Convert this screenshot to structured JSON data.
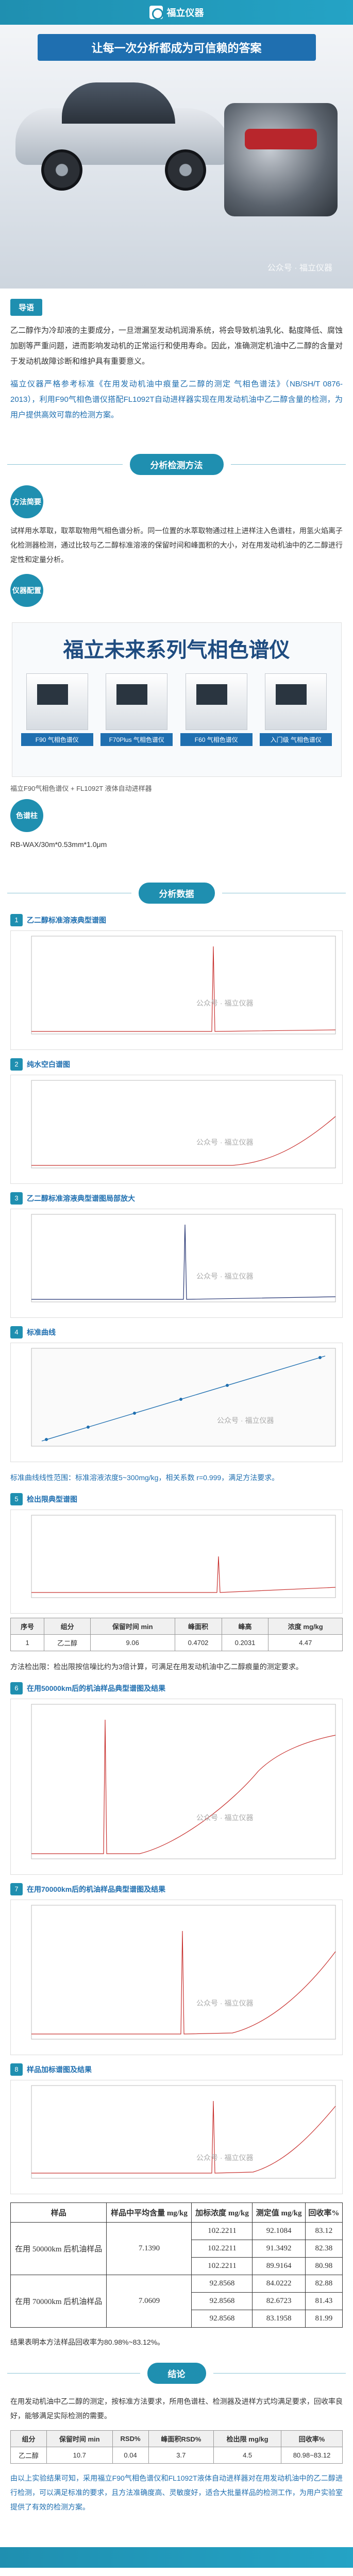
{
  "header": {
    "logo_text": "福立仪器",
    "title": "让每一次分析都成为可信赖的答案",
    "watermark": "公众号 · 福立仪器"
  },
  "intro": {
    "tag": "导语",
    "p1": "乙二醇作为冷却液的主要成分，一旦泄漏至发动机润滑系统，将会导致机油乳化、黏度降低、腐蚀加剧等严重问题，进而影响发动机的正常运行和使用寿命。因此，准确测定机油中乙二醇的含量对于发动机故障诊断和维护具有重要意义。",
    "p2": "福立仪器严格参考标准《在用发动机油中痕量乙二醇的测定 气相色谱法》（NB/SH/T 0876-2013），利用F90气相色谱仪搭配FL1092T自动进样器实现在用发动机油中乙二醇含量的检测，为用户提供高效可靠的检测方案。"
  },
  "method": {
    "section_title": "分析检测方法",
    "tag": "方法简要",
    "p1": "试样用水萃取，取萃取物用气相色谱分析。同一位置的水萃取物通过柱上进样注入色谱柱，用氢火焰离子化检测器检测，通过比较与乙二醇标准溶液的保留时间和峰面积的大小，对在用发动机油中的乙二醇进行定性和定量分析。",
    "config_tag": "仪器配置",
    "instrument_title": "福立未来系列气相色谱仪",
    "instruments": [
      "F90 气相色谱仪",
      "F70Plus 气相色谱仪",
      "F60 气相色谱仪",
      "入门级 气相色谱仪"
    ],
    "config_caption": "福立F90气相色谱仪 + FL1092T 液体自动进样器",
    "column_tag": "色谱柱",
    "column": "RB-WAX/30m*0.53mm*1.0μm"
  },
  "results": {
    "section_title": "分析数据",
    "fig1": "乙二醇标准溶液典型谱图",
    "fig2": "纯水空白谱图",
    "fig3": "乙二醇标准溶液典型谱图局部放大",
    "fig4": "标准曲线",
    "linearity": "标准曲线线性范围：标准溶液浓度5~300mg/kg，相关系数 r=0.999，满足方法要求。",
    "fig5": "检出限典型谱图",
    "lod_table": {
      "headers": [
        "序号",
        "组分",
        "保留时间 min",
        "峰面积",
        "峰高",
        "浓度 mg/kg"
      ],
      "rows": [
        [
          "1",
          "乙二醇",
          "9.06",
          "0.4702",
          "0.2031",
          "4.47"
        ]
      ]
    },
    "lod_text": "方法检出限：检出限按信噪比约为3倍计算，可满足在用发动机油中乙二醇痕量的测定要求。",
    "fig6": "在用50000km后的机油样品典型谱图及结果",
    "fig7": "在用70000km后的机油样品典型谱图及结果",
    "fig8": "样品加标谱图及结果",
    "wm": "公众号 · 福立仪器",
    "result_table": {
      "headers": [
        "样品",
        "样品中平均含量 mg/kg",
        "加标浓度 mg/kg",
        "测定值 mg/kg",
        "回收率%"
      ],
      "rows": [
        [
          "在用 50000km 后机油样品",
          "7.1390",
          "102.2211",
          "92.1084",
          "83.12"
        ],
        [
          "",
          "",
          "102.2211",
          "91.3492",
          "82.38"
        ],
        [
          "",
          "",
          "102.2211",
          "89.9164",
          "80.98"
        ],
        [
          "在用 70000km 后机油样品",
          "7.0609",
          "92.8568",
          "84.0222",
          "82.88"
        ],
        [
          "",
          "",
          "92.8568",
          "82.6723",
          "81.43"
        ],
        [
          "",
          "",
          "92.8568",
          "83.1958",
          "81.99"
        ]
      ]
    },
    "result_note": "结果表明本方法样品回收率为80.98%~83.12%。"
  },
  "conclusion": {
    "section_title": "结论",
    "text": "在用发动机油中乙二醇的测定，按标准方法要求，所用色谱柱、检测器及进样方式均满足要求，回收率良好，能够满足实际检测的需要。",
    "table": {
      "headers": [
        "组分",
        "保留时间 min",
        "RSD%",
        "峰面积RSD%",
        "检出限 mg/kg",
        "回收率%"
      ],
      "rows": [
        [
          "乙二醇",
          "10.7",
          "0.04",
          "3.7",
          "4.5",
          "80.98~83.12"
        ]
      ]
    },
    "summary": "由以上实验结果可知，采用福立F90气相色谱仪和FL1092T液体自动进样器对在用发动机油中的乙二醇进行检测，可以满足标准的要求，且方法准确度高、灵敏度好，适合大批量样品的检测工作，为用户实验室提供了有效的检测方案。"
  },
  "chart_data": [
    {
      "type": "line",
      "title": "乙二醇标准溶液典型谱图",
      "x": [
        0,
        1,
        2,
        3,
        4,
        5,
        6,
        7,
        8,
        9,
        10,
        11,
        12,
        13,
        14,
        15
      ],
      "y": [
        0,
        0,
        0,
        0,
        0,
        0,
        0,
        0,
        0,
        0,
        0.2,
        10,
        0.3,
        0.5,
        1,
        2
      ]
    },
    {
      "type": "line",
      "title": "纯水空白谱图",
      "x": [
        0,
        1,
        2,
        3,
        4,
        5,
        6,
        7,
        8,
        9,
        10,
        11,
        12,
        13,
        14,
        15
      ],
      "y": [
        0,
        0,
        0,
        0,
        0,
        0,
        0,
        0,
        0,
        0,
        0.1,
        0.2,
        0.5,
        1.5,
        3,
        6
      ]
    },
    {
      "type": "scatter",
      "title": "标准曲线",
      "x": [
        5,
        50,
        100,
        150,
        200,
        300
      ],
      "y": [
        1.5,
        11,
        22,
        33,
        44,
        66
      ]
    }
  ]
}
